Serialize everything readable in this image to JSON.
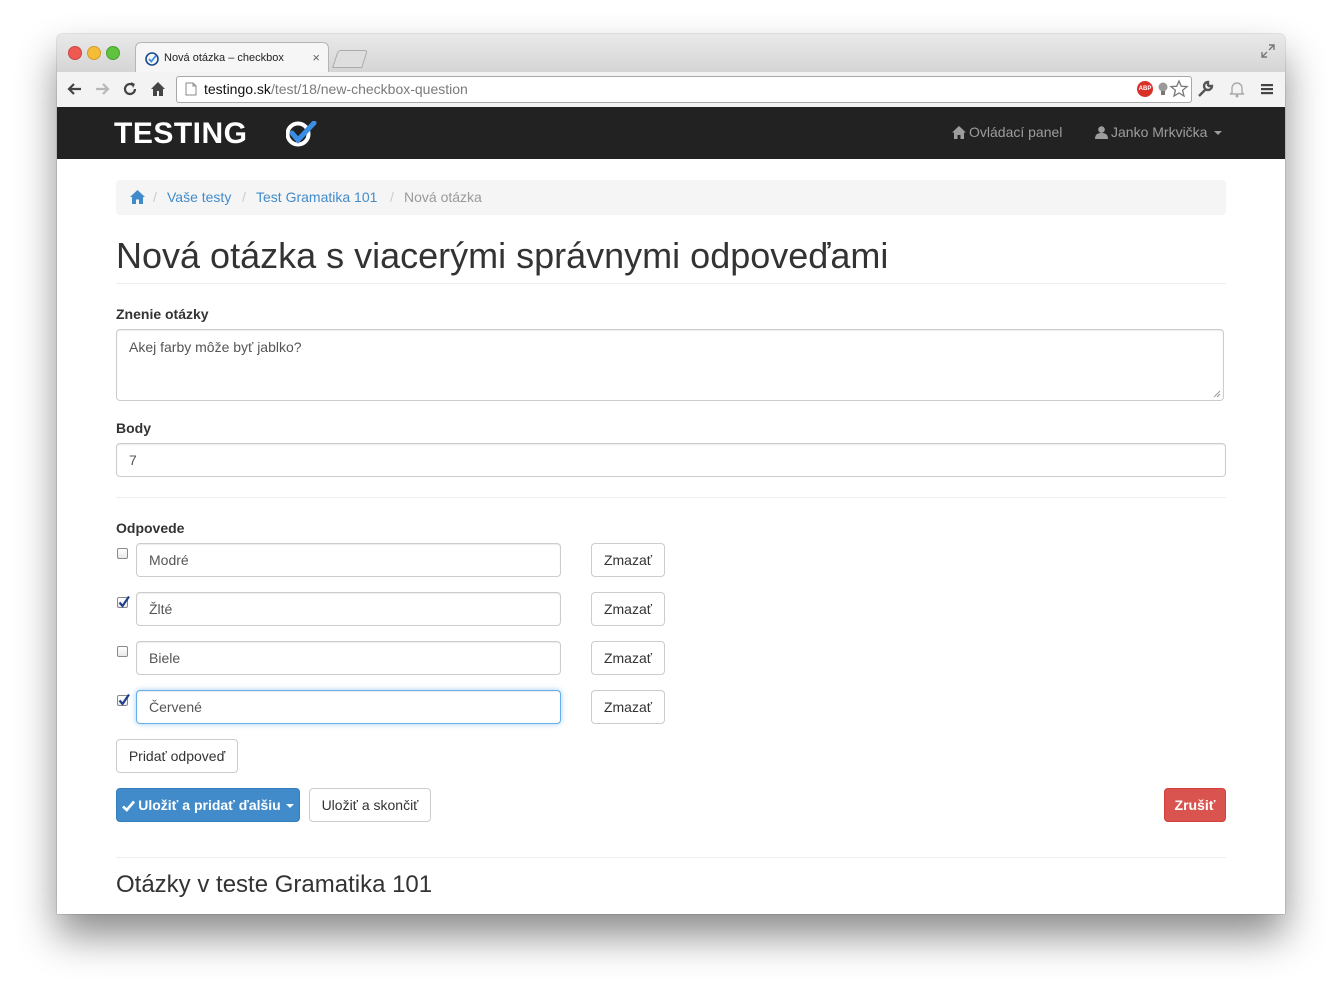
{
  "browser": {
    "tab_title": "Nová otázka – checkbox",
    "tab_close": "×",
    "url_host": "testingo.sk",
    "url_path": "/test/18/new-checkbox-question",
    "abp_label": "ABP"
  },
  "navbar": {
    "brand": "TESTING",
    "dashboard_label": "Ovládací panel",
    "user_label": "Janko Mrkvička"
  },
  "breadcrumb": {
    "items": [
      "Vaše testy",
      "Test Gramatika 101"
    ],
    "active": "Nová otázka",
    "separator": "/"
  },
  "page_title": "Nová otázka s viacerými správnymi odpoveďami",
  "form": {
    "question_label": "Znenie otázky",
    "question_value": "Akej farby môže byť jablko?",
    "points_label": "Body",
    "points_value": "7",
    "answers_label": "Odpovede",
    "answers": [
      {
        "text": "Modré",
        "checked": false,
        "delete_label": "Zmazať"
      },
      {
        "text": "Žlté",
        "checked": true,
        "delete_label": "Zmazať"
      },
      {
        "text": "Biele",
        "checked": false,
        "delete_label": "Zmazať"
      },
      {
        "text": "Červené",
        "checked": true,
        "delete_label": "Zmazať",
        "focused": true
      }
    ],
    "add_answer_label": "Pridať odpoveď",
    "save_add_label": "Uložiť a pridať ďalšiu",
    "save_finish_label": "Uložiť a skončiť",
    "cancel_label": "Zrušiť"
  },
  "questions_heading": "Otázky v teste Gramatika 101",
  "colors": {
    "navbar": "#222222",
    "primary": "#428bca",
    "danger": "#d9534f",
    "brand_check": "#3a8ee6"
  }
}
